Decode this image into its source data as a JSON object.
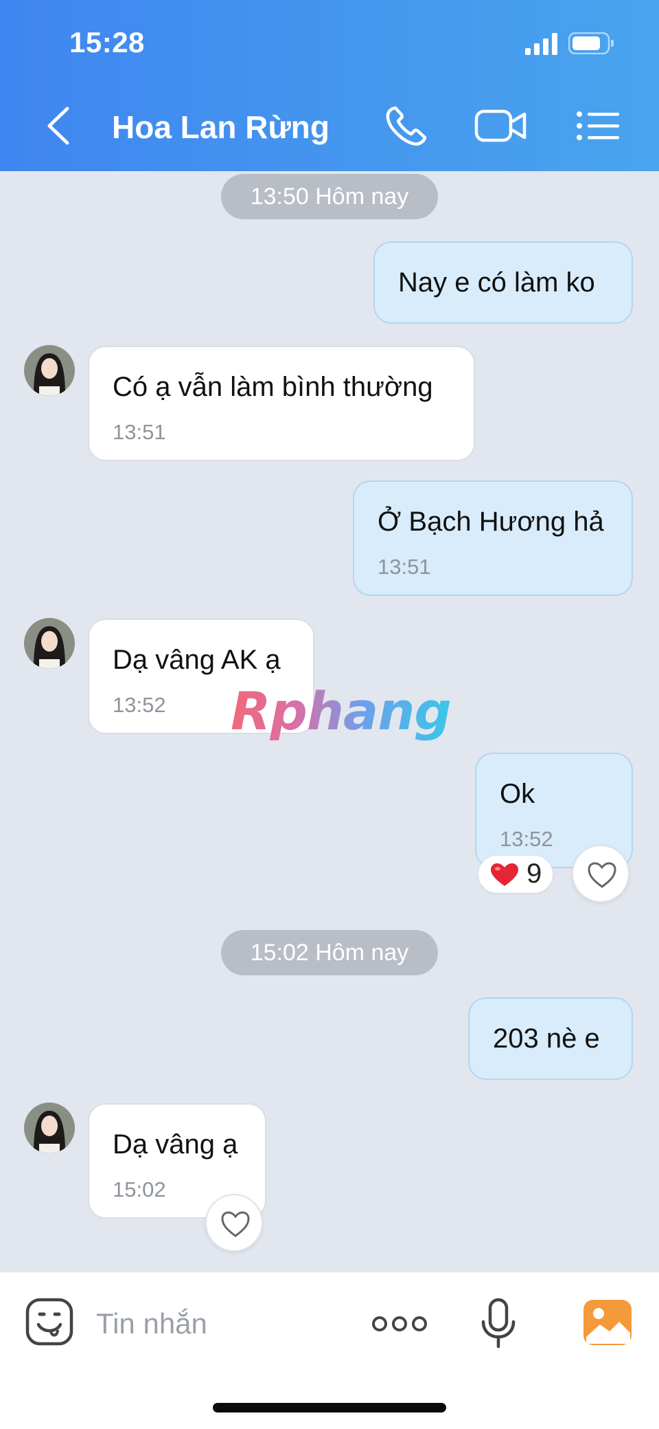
{
  "status_bar": {
    "time": "15:28"
  },
  "header": {
    "title": "Hoa Lan Rừng",
    "icons": [
      "back-icon",
      "phone-icon",
      "video-icon",
      "menu-list-icon"
    ]
  },
  "messages": {
    "divider_1": "13:50 Hôm nay",
    "m1": {
      "text": "Nay e có làm ko"
    },
    "m2": {
      "text": "Có ạ vẫn làm bình thường",
      "time": "13:51"
    },
    "m3": {
      "text": "Ở Bạch Hương hả",
      "time": "13:51"
    },
    "m4": {
      "text": "Dạ vâng AK ạ",
      "time": "13:52"
    },
    "m5": {
      "text": "Ok",
      "time": "13:52",
      "reaction_count": "9"
    },
    "divider_2": "15:02 Hôm nay",
    "m6": {
      "text": "203 nè e"
    },
    "m7": {
      "text": "Dạ vâng ạ",
      "time": "15:02"
    }
  },
  "watermark": "Rphang",
  "composer": {
    "placeholder": "Tin nhắn"
  },
  "colors": {
    "header_start": "#3f86f0",
    "header_end": "#4aa4ee",
    "outgoing_bubble": "#d8ecfb",
    "incoming_bubble": "#ffffff",
    "chat_background": "#e2e7ef",
    "reaction_heart": "#e32636",
    "gallery_icon": "#f59a3a"
  }
}
